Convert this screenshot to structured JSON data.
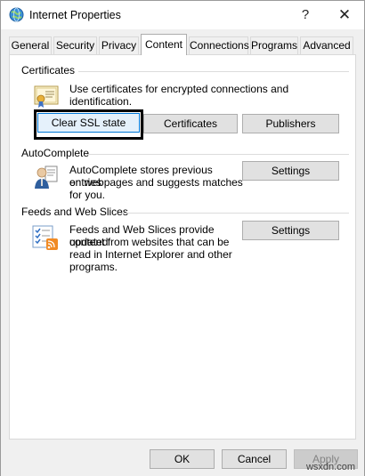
{
  "window": {
    "title": "Internet Properties",
    "help_glyph": "?",
    "close_glyph": "✕"
  },
  "tabs": [
    {
      "label": "General"
    },
    {
      "label": "Security"
    },
    {
      "label": "Privacy"
    },
    {
      "label": "Content",
      "active": true
    },
    {
      "label": "Connections"
    },
    {
      "label": "Programs"
    },
    {
      "label": "Advanced"
    }
  ],
  "certificates": {
    "title": "Certificates",
    "description": "Use certificates for encrypted connections and identification.",
    "icon": "certificate-icon",
    "clear_ssl_label": "Clear SSL state",
    "certificates_label": "Certificates",
    "publishers_label": "Publishers"
  },
  "autocomplete": {
    "title": "AutoComplete",
    "description_lines": [
      "AutoComplete stores previous entries",
      "on webpages and suggests matches",
      "for you."
    ],
    "icon": "autocomplete-user-icon",
    "settings_label": "Settings"
  },
  "feeds": {
    "title": "Feeds and Web Slices",
    "description_lines": [
      "Feeds and Web Slices provide updated",
      "content from websites that can be",
      "read in Internet Explorer and other",
      "programs."
    ],
    "icon": "feeds-checklist-icon",
    "settings_label": "Settings"
  },
  "footer": {
    "ok_label": "OK",
    "cancel_label": "Cancel",
    "apply_label": "Apply"
  },
  "watermark": "wsxdn.com",
  "colors": {
    "focus_border": "#0078d7",
    "focus_fill": "#e5f1fb",
    "button_fill": "#e1e1e1",
    "panel_bg": "#ffffff",
    "window_bg": "#f0f0f0"
  }
}
